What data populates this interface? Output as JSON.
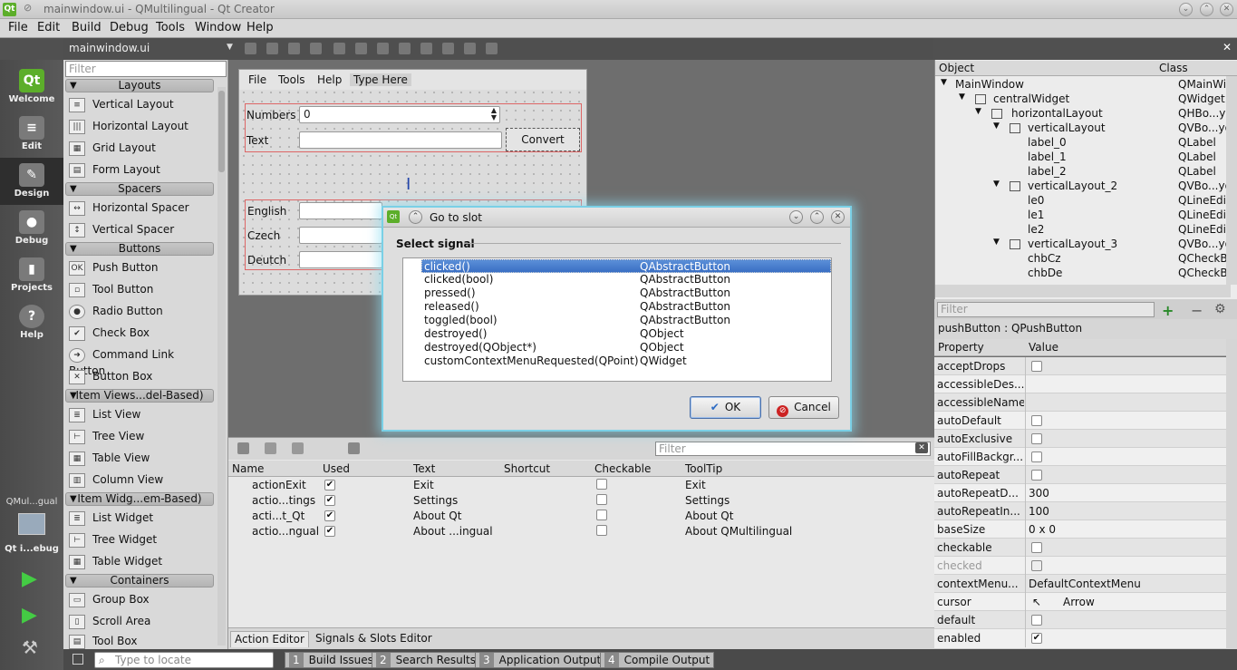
{
  "window": {
    "title": "mainwindow.ui - QMultilingual - Qt Creator"
  },
  "menubar": [
    "File",
    "Edit",
    "Build",
    "Debug",
    "Tools",
    "Window",
    "Help"
  ],
  "modes": [
    {
      "label": "Welcome",
      "icon": "qt-logo-icon"
    },
    {
      "label": "Edit",
      "icon": "edit-document-icon"
    },
    {
      "label": "Design",
      "icon": "design-brush-icon"
    },
    {
      "label": "Debug",
      "icon": "debug-bug-icon"
    },
    {
      "label": "Projects",
      "icon": "projects-icon"
    },
    {
      "label": "Help",
      "icon": "help-icon"
    }
  ],
  "kit": {
    "project": "QMul...gual",
    "config": "Qt i...ebug"
  },
  "editor": {
    "filename": "mainwindow.ui"
  },
  "widgetbox": {
    "filter_placeholder": "Filter",
    "categories": {
      "layouts": "Layouts",
      "spacers": "Spacers",
      "buttons": "Buttons",
      "itemviews": "Item Views...del-Based)",
      "itemwidgets": "Item Widg...em-Based)",
      "containers": "Containers"
    },
    "items": {
      "vertical_layout": "Vertical Layout",
      "horizontal_layout": "Horizontal Layout",
      "grid_layout": "Grid Layout",
      "form_layout": "Form Layout",
      "horizontal_spacer": "Horizontal Spacer",
      "vertical_spacer": "Vertical Spacer",
      "push_button": "Push Button",
      "tool_button": "Tool Button",
      "radio_button": "Radio Button",
      "check_box": "Check Box",
      "command_link_button": "Command Link Button",
      "button_box": "Button Box",
      "list_view": "List View",
      "tree_view": "Tree View",
      "table_view": "Table View",
      "column_view": "Column View",
      "list_widget": "List Widget",
      "tree_widget": "Tree Widget",
      "table_widget": "Table Widget",
      "group_box": "Group Box",
      "scroll_area": "Scroll Area",
      "tool_box": "Tool Box"
    }
  },
  "form": {
    "menu": [
      "File",
      "Tools",
      "Help",
      "Type Here"
    ],
    "labels": {
      "numbers": "Numbers",
      "text": "Text",
      "english": "English",
      "czech": "Czech",
      "deutch": "Deutch"
    },
    "numbers_value": "0",
    "convert_label": "Convert"
  },
  "action_editor": {
    "filter_placeholder": "Filter",
    "columns": [
      "Name",
      "Used",
      "Text",
      "Shortcut",
      "Checkable",
      "ToolTip"
    ],
    "rows": [
      {
        "name": "actionExit",
        "text": "Exit",
        "tooltip": "Exit"
      },
      {
        "name": "actio...tings",
        "text": "Settings",
        "tooltip": "Settings"
      },
      {
        "name": "acti...t_Qt",
        "text": "About Qt",
        "tooltip": "About Qt"
      },
      {
        "name": "actio...ngual",
        "text": "About ...ingual",
        "tooltip": "About QMultilingual"
      }
    ],
    "tabs": [
      "Action Editor",
      "Signals & Slots Editor"
    ]
  },
  "statusbar": {
    "locate_placeholder": "Type to locate",
    "tabs": [
      {
        "n": "1",
        "label": "Build Issues"
      },
      {
        "n": "2",
        "label": "Search Results"
      },
      {
        "n": "3",
        "label": "Application Output"
      },
      {
        "n": "4",
        "label": "Compile Output"
      }
    ]
  },
  "object_inspector": {
    "columns": [
      "Object",
      "Class"
    ],
    "rows": [
      {
        "name": "MainWindow",
        "cls": "QMainWindo"
      },
      {
        "name": "centralWidget",
        "cls": "QWidget"
      },
      {
        "name": "horizontalLayout",
        "cls": "QHBo...yout"
      },
      {
        "name": "verticalLayout",
        "cls": "QVBo...yout"
      },
      {
        "name": "label_0",
        "cls": "QLabel"
      },
      {
        "name": "label_1",
        "cls": "QLabel"
      },
      {
        "name": "label_2",
        "cls": "QLabel"
      },
      {
        "name": "verticalLayout_2",
        "cls": "QVBo...yout"
      },
      {
        "name": "le0",
        "cls": "QLineEdi"
      },
      {
        "name": "le1",
        "cls": "QLineEdi"
      },
      {
        "name": "le2",
        "cls": "QLineEdi"
      },
      {
        "name": "verticalLayout_3",
        "cls": "QVBo...yout"
      },
      {
        "name": "chbCz",
        "cls": "QCheckB"
      },
      {
        "name": "chbDe",
        "cls": "QCheckB"
      }
    ]
  },
  "property_editor": {
    "filter_placeholder": "Filter",
    "object": "pushButton : QPushButton",
    "columns": [
      "Property",
      "Value"
    ],
    "rows": [
      {
        "name": "acceptDrops",
        "value": ""
      },
      {
        "name": "accessibleDes...",
        "value": ""
      },
      {
        "name": "accessibleName",
        "value": ""
      },
      {
        "name": "autoDefault",
        "value": ""
      },
      {
        "name": "autoExclusive",
        "value": ""
      },
      {
        "name": "autoFillBackgr...",
        "value": ""
      },
      {
        "name": "autoRepeat",
        "value": ""
      },
      {
        "name": "autoRepeatD...",
        "value": "300"
      },
      {
        "name": "autoRepeatIn...",
        "value": "100"
      },
      {
        "name": "baseSize",
        "value": "0 x 0"
      },
      {
        "name": "checkable",
        "value": ""
      },
      {
        "name": "checked",
        "value": ""
      },
      {
        "name": "contextMenu...",
        "value": "DefaultContextMenu"
      },
      {
        "name": "cursor",
        "value": "Arrow"
      },
      {
        "name": "default",
        "value": ""
      },
      {
        "name": "enabled",
        "value": ""
      }
    ]
  },
  "dialog": {
    "title": "Go to slot",
    "section": "Select signal",
    "signals": [
      {
        "signal": "clicked()",
        "cls": "QAbstractButton",
        "selected": true
      },
      {
        "signal": "clicked(bool)",
        "cls": "QAbstractButton"
      },
      {
        "signal": "pressed()",
        "cls": "QAbstractButton"
      },
      {
        "signal": "released()",
        "cls": "QAbstractButton"
      },
      {
        "signal": "toggled(bool)",
        "cls": "QAbstractButton"
      },
      {
        "signal": "destroyed()",
        "cls": "QObject"
      },
      {
        "signal": "destroyed(QObject*)",
        "cls": "QObject"
      },
      {
        "signal": "customContextMenuRequested(QPoint)",
        "cls": "QWidget"
      }
    ],
    "ok": "OK",
    "cancel": "Cancel"
  },
  "colors": {
    "selection": "#3a6fc4",
    "dialog_glow": "#7ad0e6",
    "qt_green": "#5cae2a"
  }
}
